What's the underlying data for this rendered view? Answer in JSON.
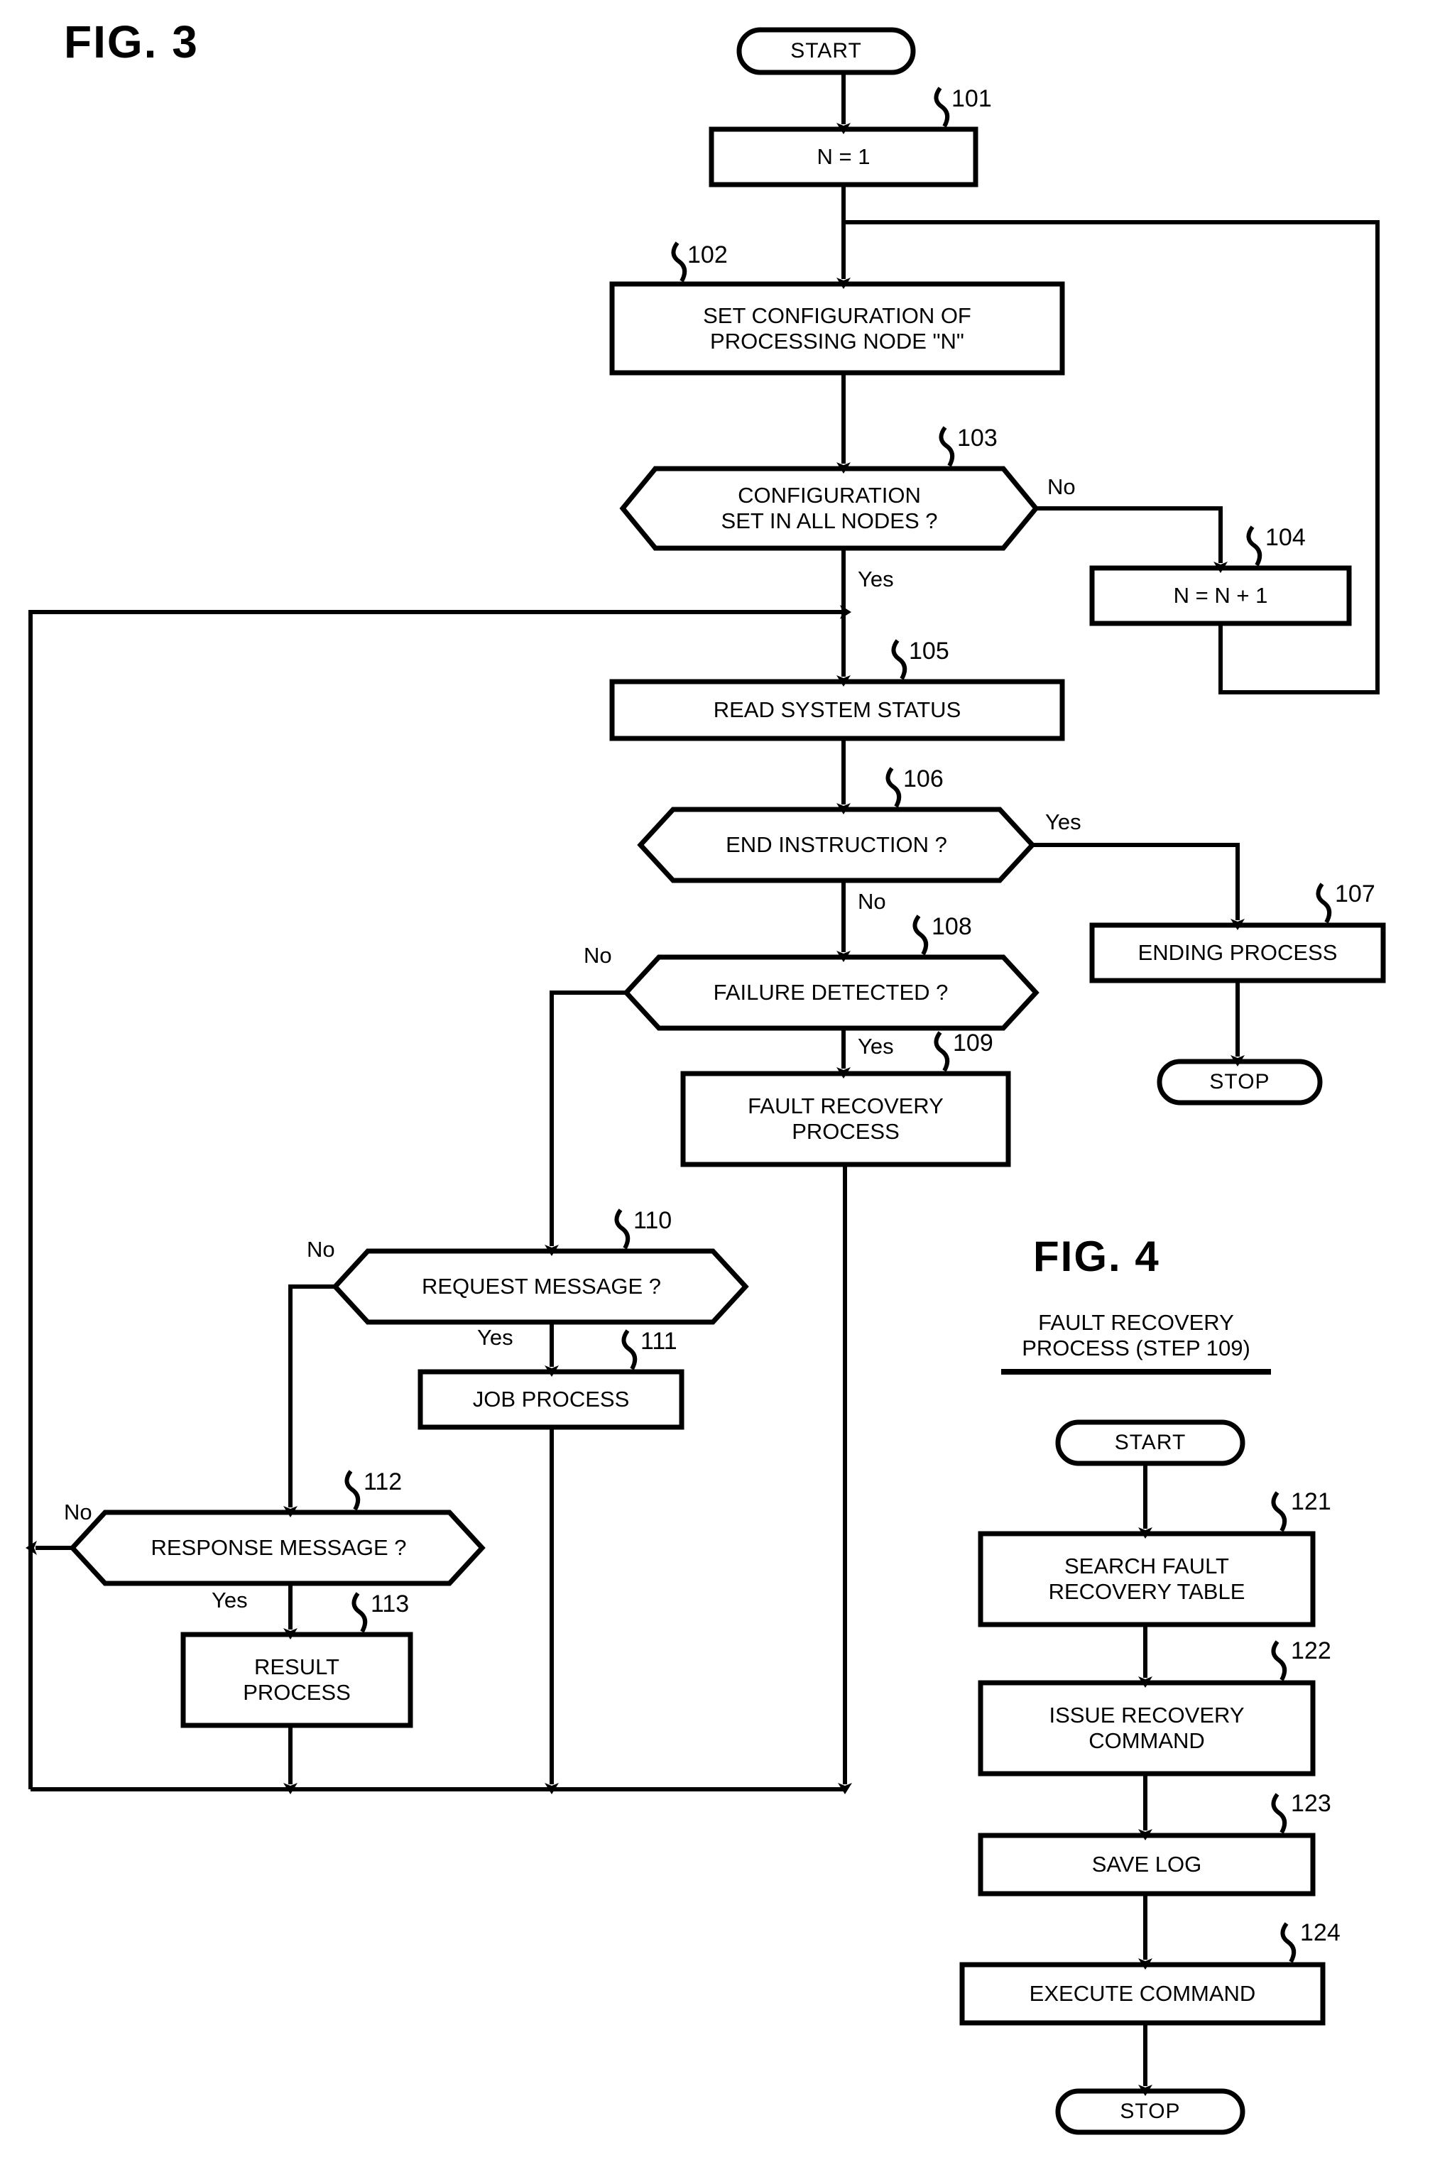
{
  "figures": {
    "fig3": {
      "title": "FIG. 3"
    },
    "fig4": {
      "title": "FIG. 4",
      "subtitle": "FAULT RECOVERY\nPROCESS (STEP 109)"
    }
  },
  "fig3_nodes": {
    "start": {
      "label": "START"
    },
    "s101": {
      "label": "N = 1",
      "ref": "101"
    },
    "s102": {
      "label": "SET CONFIGURATION OF\nPROCESSING NODE \"N\"",
      "ref": "102"
    },
    "s103": {
      "label": "CONFIGURATION\nSET IN ALL NODES ?",
      "ref": "103"
    },
    "s104": {
      "label": "N = N + 1",
      "ref": "104"
    },
    "s105": {
      "label": "READ SYSTEM STATUS",
      "ref": "105"
    },
    "s106": {
      "label": "END INSTRUCTION ?",
      "ref": "106"
    },
    "s107": {
      "label": "ENDING PROCESS",
      "ref": "107"
    },
    "stop": {
      "label": "STOP"
    },
    "s108": {
      "label": "FAILURE DETECTED ?",
      "ref": "108"
    },
    "s109": {
      "label": "FAULT RECOVERY\nPROCESS",
      "ref": "109"
    },
    "s110": {
      "label": "REQUEST MESSAGE ?",
      "ref": "110"
    },
    "s111": {
      "label": "JOB PROCESS",
      "ref": "111"
    },
    "s112": {
      "label": "RESPONSE MESSAGE ?",
      "ref": "112"
    },
    "s113": {
      "label": "RESULT\nPROCESS",
      "ref": "113"
    }
  },
  "fig3_branches": {
    "b103_no": "No",
    "b103_yes": "Yes",
    "b106_yes": "Yes",
    "b106_no": "No",
    "b108_no": "No",
    "b108_yes": "Yes",
    "b110_no": "No",
    "b110_yes": "Yes",
    "b112_no": "No",
    "b112_yes": "Yes"
  },
  "fig4_nodes": {
    "start": {
      "label": "START"
    },
    "s121": {
      "label": "SEARCH FAULT\nRECOVERY TABLE",
      "ref": "121"
    },
    "s122": {
      "label": "ISSUE RECOVERY\nCOMMAND",
      "ref": "122"
    },
    "s123": {
      "label": "SAVE LOG",
      "ref": "123"
    },
    "s124": {
      "label": "EXECUTE COMMAND",
      "ref": "124"
    },
    "stop": {
      "label": "STOP"
    }
  },
  "colors": {
    "ink": "#000000",
    "paper": "#ffffff"
  }
}
